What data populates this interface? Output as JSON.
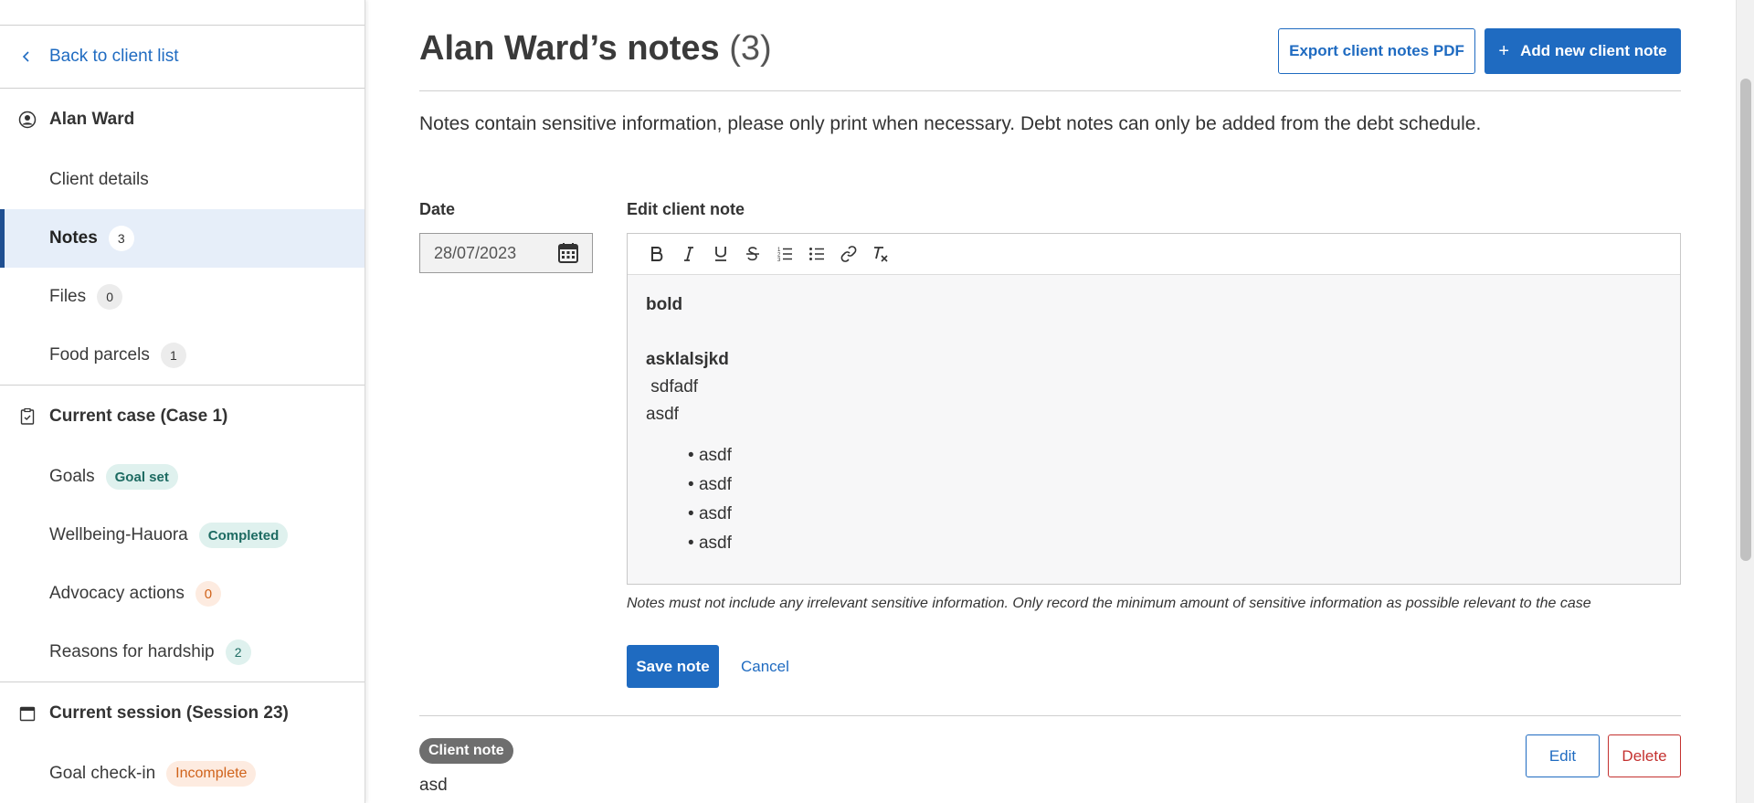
{
  "sidebar": {
    "back_label": "Back to client list",
    "client": {
      "name": "Alan Ward",
      "items": [
        {
          "label": "Client details",
          "badge": ""
        },
        {
          "label": "Notes",
          "badge": "3"
        },
        {
          "label": "Files",
          "badge": "0"
        },
        {
          "label": "Food parcels",
          "badge": "1"
        }
      ]
    },
    "case": {
      "title": "Current case (Case 1)",
      "items": [
        {
          "label": "Goals",
          "badge": "Goal set"
        },
        {
          "label": "Wellbeing-Hauora",
          "badge": "Completed"
        },
        {
          "label": "Advocacy actions",
          "badge": "0"
        },
        {
          "label": "Reasons for hardship",
          "badge": "2"
        }
      ]
    },
    "session": {
      "title": "Current session (Session 23)",
      "items": [
        {
          "label": "Goal check-in",
          "badge": "Incomplete"
        }
      ]
    }
  },
  "header": {
    "title": "Alan Ward’s notes",
    "count": "(3)",
    "export_label": "Export client notes PDF",
    "add_label": "Add new client note"
  },
  "info": "Notes contain sensitive information, please only print when necessary. Debt notes can only be added from the debt schedule.",
  "form": {
    "date_label": "Date",
    "date_value": "28/07/2023",
    "edit_label": "Edit client note",
    "editor": {
      "line1": "bold",
      "line2": "asklalsjkd",
      "line3": " sdfadf",
      "line4": "asdf",
      "bullets": [
        "asdf",
        "asdf",
        "asdf",
        "asdf"
      ]
    },
    "hint": "Notes must not include any irrelevant sensitive information. Only record the minimum amount of sensitive information as possible relevant to the case",
    "save_label": "Save note",
    "cancel_label": "Cancel"
  },
  "note": {
    "tag": "Client note",
    "text": "asd",
    "edit_label": "Edit",
    "delete_label": "Delete"
  },
  "colors": {
    "primary": "#1f6bc1",
    "danger": "#c4312f",
    "active_bg": "#e6eef9"
  }
}
